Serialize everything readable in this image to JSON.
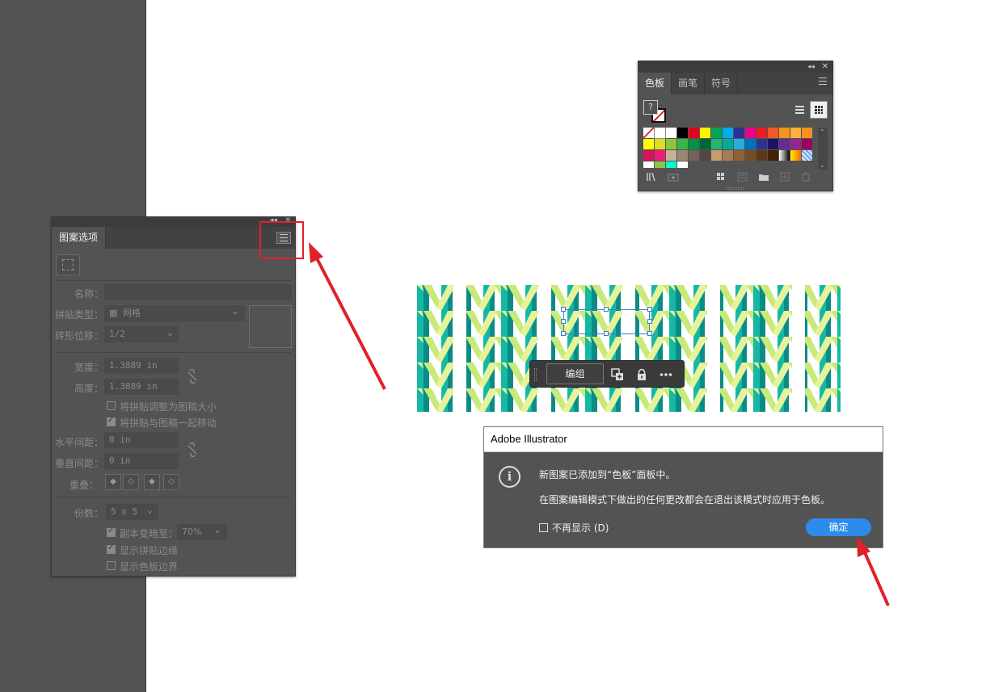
{
  "swatches_panel": {
    "tabs": [
      "色板",
      "画笔",
      "符号"
    ],
    "active_tab": "色板",
    "fill_glyph": "?",
    "icons": [
      "collapse-icon",
      "close-icon",
      "panel-menu-icon",
      "list-view-icon",
      "grid-view-icon",
      "library-icon",
      "show-kinds-icon",
      "new-color-group-icon",
      "swatch-options-icon",
      "folder-icon",
      "new-swatch-icon",
      "delete-icon"
    ],
    "colors": [
      "#ffffff",
      "#ffffff",
      "#ffffff",
      "#000000",
      "#e3001b",
      "#fff200",
      "#00a651",
      "#00aeef",
      "#2e3192",
      "#ec008c",
      "#ed1c24",
      "#f15a24",
      "#f7941d",
      "#fbb03b",
      "#f7931e",
      "#ffff00",
      "#d9e021",
      "#8cc63f",
      "#39b54a",
      "#009245",
      "#006837",
      "#22b573",
      "#00a99d",
      "#29abe2",
      "#0071bc",
      "#2e3192",
      "#1b1464",
      "#662d91",
      "#93278f",
      "#9e005d",
      "#d4145a",
      "#ed1e79",
      "#c7b299",
      "#998675",
      "#736357",
      "#534741",
      "#c69c6d",
      "#a67c52",
      "#8c6239",
      "#754c24",
      "#603813",
      "#42210b",
      "#e6e6e6",
      "#fbb03b",
      "#a0c8f0",
      "#ffffff",
      "#8cc63f",
      "#00ffcc",
      "#ffffff"
    ]
  },
  "pattern_panel": {
    "tab": "图案选项",
    "name_label": "名称：",
    "name_value": "",
    "tile_type_label": "拼贴类型：",
    "tile_type_value": "网格",
    "brick_offset_label": "砖形位移：",
    "brick_offset_value": "1/2",
    "width_label": "宽度：",
    "width_value": "1.3889 in",
    "height_label": "高度：",
    "height_value": "1.3889 in",
    "size_tile_to_art": "将拼贴调整为图稿大小",
    "move_tile_with_art": "将拼贴与图稿一起移动",
    "h_spacing_label": "水平间距：",
    "h_spacing_value": "0 in",
    "v_spacing_label": "垂直间距：",
    "v_spacing_value": "0 in",
    "overlap_label": "重叠：",
    "copies_label": "份数：",
    "copies_value": "5 x 5",
    "dim_copies_label": "副本变暗至：",
    "dim_copies_value": "70%",
    "show_tile_edge": "显示拼贴边缘",
    "show_swatch_bounds": "显示色板边界",
    "size_tile_to_art_checked": false,
    "move_tile_with_art_checked": true,
    "dim_copies_checked": true,
    "show_tile_edge_checked": true,
    "show_swatch_bounds_checked": false
  },
  "context_bar": {
    "group_label": "编组"
  },
  "dialog": {
    "title": "Adobe Illustrator",
    "line1": "新图案已添加到“色板”面板中。",
    "line2": "在图案编辑模式下做出的任何更改都会在退出该模式时应用于色板。",
    "dont_show": "不再显示 (D)",
    "ok_label": "确定"
  },
  "colors": {
    "ui_bg": "#535353",
    "annotation_red": "#e0202a",
    "ok_blue": "#2d8ceb",
    "pattern_teal": "#15b8a5",
    "pattern_dark_teal": "#0a8b86",
    "pattern_lime": "#c9ea7a",
    "pattern_pale": "#e6f39a"
  }
}
